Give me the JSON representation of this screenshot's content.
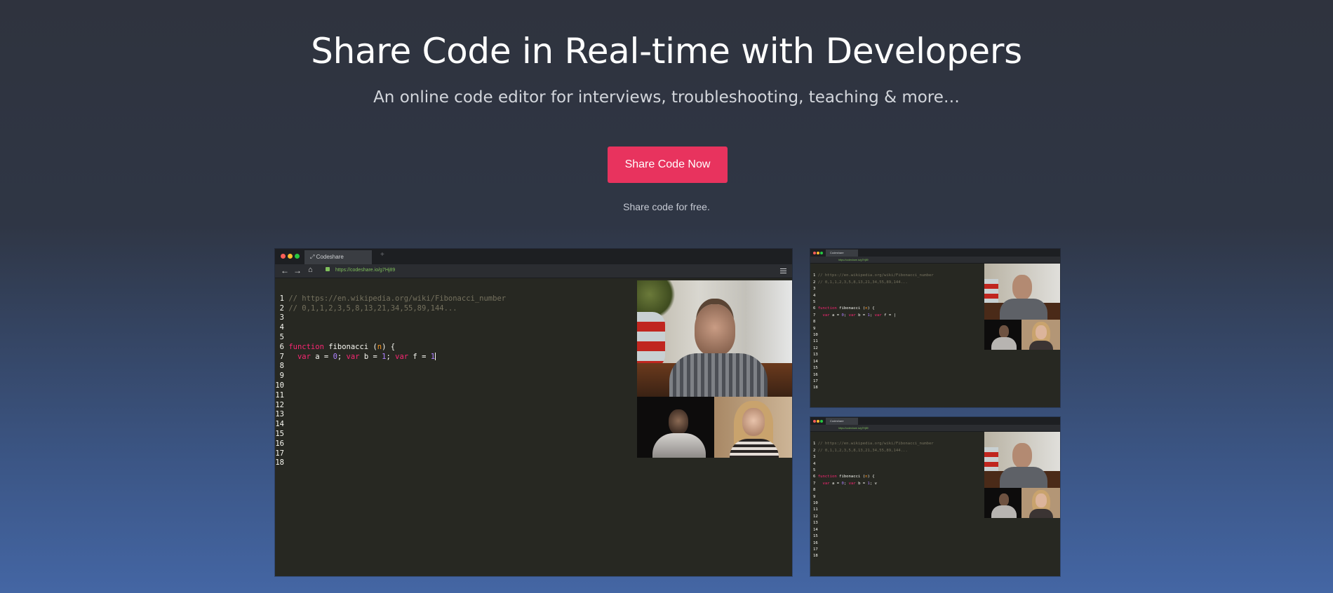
{
  "hero": {
    "title": "Share Code in Real-time with Developers",
    "subtitle": "An online code editor for interviews, troubleshooting, teaching & more…",
    "cta_label": "Share Code Now",
    "free_note": "Share code for free."
  },
  "browser": {
    "tab_title": "Codeshare",
    "new_tab": "+",
    "back_icon": "arrow-left-icon",
    "forward_icon": "arrow-right-icon",
    "home_icon": "home-icon",
    "lock_icon": "lock-icon",
    "url": "https://codeshare.io/g7Hj89",
    "menu_icon": "hamburger-icon"
  },
  "editor": {
    "line_numbers": [
      "1",
      "2",
      "3",
      "4",
      "5",
      "6",
      "7",
      "8",
      "9",
      "10",
      "11",
      "12",
      "13",
      "14",
      "15",
      "16",
      "17",
      "18"
    ],
    "line1": "// https://en.wikipedia.org/wiki/Fibonacci_number",
    "line2": "// 0,1,1,2,3,5,8,13,21,34,55,89,144...",
    "kw_function": "function",
    "fn_name": "fibonacci",
    "param": "n",
    "kw_var": "var",
    "var_a": "a",
    "var_b": "b",
    "var_f": "f",
    "num_zero": "0",
    "num_one": "1",
    "line7_small_top": "var f = |",
    "line7_small_bottom": "v"
  },
  "colors": {
    "accent": "#e8335e",
    "editor_bg": "#272822",
    "comment": "#75715e",
    "keyword": "#f92672",
    "param": "#fd971f",
    "number": "#ae81ff"
  }
}
